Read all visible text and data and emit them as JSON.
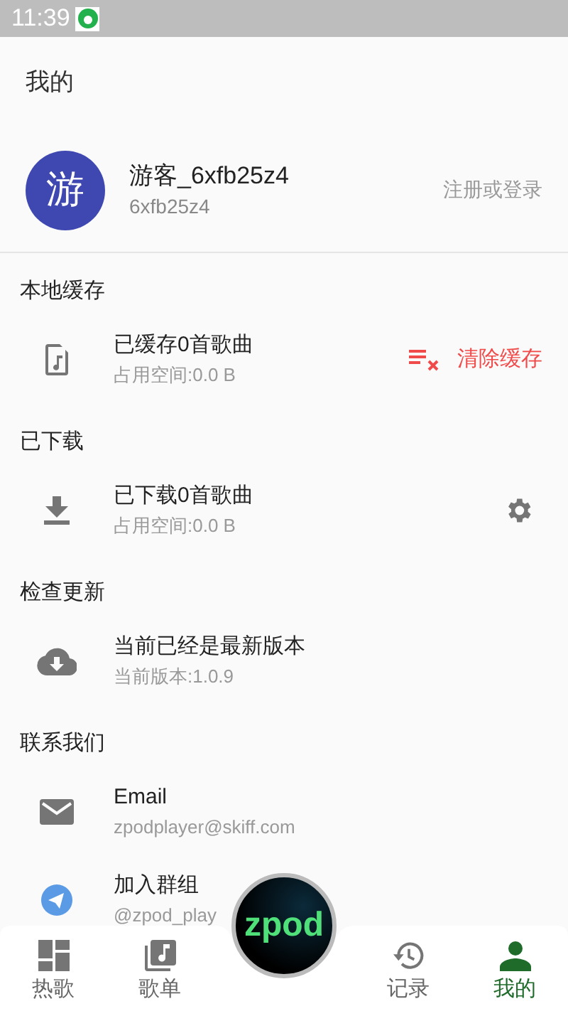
{
  "status_bar": {
    "time": "11:39"
  },
  "page_title": "我的",
  "profile": {
    "avatar": "游",
    "name": "游客_6xfb25z4",
    "id": "6xfb25z4",
    "login": "注册或登录"
  },
  "sections": [
    {
      "title": "本地缓存",
      "items": [
        {
          "title": "已缓存0首歌曲",
          "subtitle": "占用空间:0.0 B",
          "action": "清除缓存"
        }
      ]
    },
    {
      "title": "已下载",
      "items": [
        {
          "title": "已下载0首歌曲",
          "subtitle": "占用空间:0.0 B"
        }
      ]
    },
    {
      "title": "检查更新",
      "items": [
        {
          "title": "当前已经是最新版本",
          "subtitle": "当前版本:1.0.9"
        }
      ]
    },
    {
      "title": "联系我们",
      "items": [
        {
          "title": "Email",
          "subtitle": "zpodplayer@skiff.com"
        },
        {
          "title": "加入群组",
          "subtitle": "@zpod_play"
        }
      ]
    }
  ],
  "center_button": "zpod",
  "nav": [
    {
      "label": "热歌",
      "selected": false
    },
    {
      "label": "歌单",
      "selected": false
    },
    {
      "label": "记录",
      "selected": false
    },
    {
      "label": "我的",
      "selected": true
    }
  ]
}
